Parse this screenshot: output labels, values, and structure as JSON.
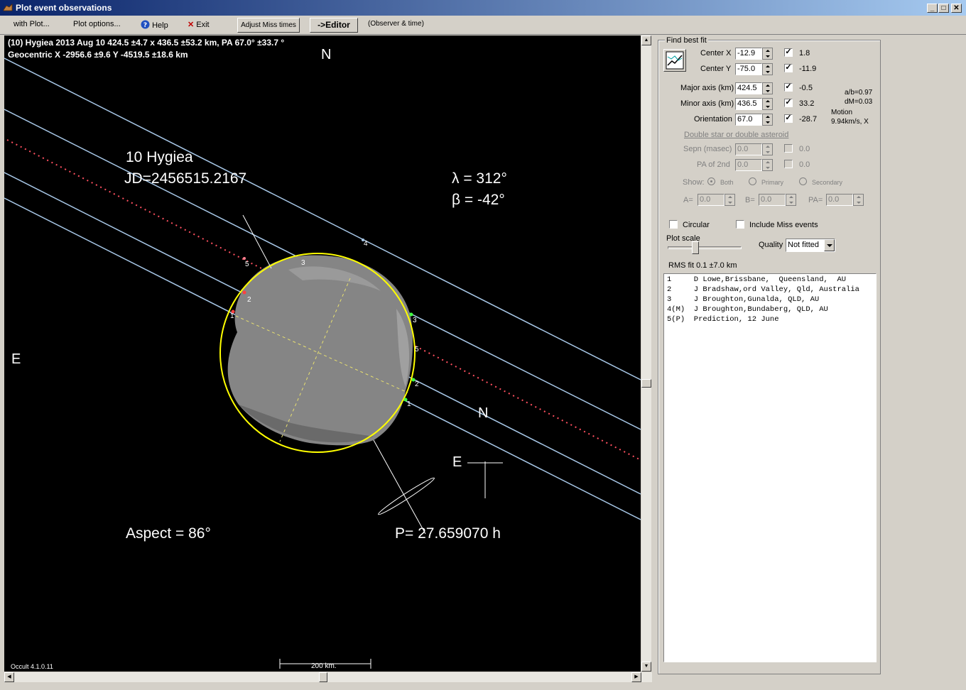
{
  "window": {
    "title": "Plot event observations",
    "buttons": {
      "minimize": "_",
      "maximize": "□",
      "close": "✕"
    }
  },
  "menu": {
    "with_plot": "with Plot...",
    "plot_options": "Plot options...",
    "help": "Help",
    "exit": "Exit",
    "adjust_miss": "Adjust Miss times",
    "editor": "->Editor",
    "observer_time": "(Observer & time)"
  },
  "plot": {
    "header_line1": "(10) Hygiea  2013 Aug 10   424.5 ±4.7 x 436.5 ±53.2 km, PA 67.0° ±33.7 °",
    "header_line2": "Geocentric X -2956.6 ±9.6  Y -4519.5 ±18.6 km",
    "north_label": "N",
    "east_label": "E",
    "asteroid_name": "10 Hygiea",
    "jd": "JD=2456515.2167",
    "lambda": "λ =  312°",
    "beta": "β =  -42°",
    "aspect": "Aspect = 86°",
    "period": "P= 27.659070 h",
    "compass_n": "N",
    "compass_e": "E",
    "scale_label": "200 km.",
    "version": "Occult 4.1.0.11",
    "chord_labels": [
      "1",
      "2",
      "3",
      "4",
      "5"
    ],
    "colors": {
      "chord": "#a8c8e8",
      "prediction": "#ff5060",
      "ellipse": "#ffff00",
      "disappear": "#ff4040",
      "reappear": "#40ff40"
    }
  },
  "panel": {
    "find_best_fit": "Find best fit",
    "center_x": {
      "label": "Center X",
      "value": "-12.9",
      "checked": "✓",
      "delta": "1.8"
    },
    "center_y": {
      "label": "Center Y",
      "value": "-75.0",
      "checked": "✓",
      "delta": "-11.9"
    },
    "major": {
      "label": "Major axis (km)",
      "value": "424.5",
      "checked": "✓",
      "delta": "-0.5"
    },
    "minor": {
      "label": "Minor axis (km)",
      "value": "436.5",
      "checked": "✓",
      "delta": "33.2"
    },
    "orient": {
      "label": "Orientation",
      "value": "67.0",
      "checked": "✓",
      "delta": "-28.7"
    },
    "ab": "a/b=0.97",
    "dm": "dM=0.03",
    "motion_label": "Motion",
    "motion_value": "9.94km/s, X",
    "double_star": "Double star  or  double asteroid",
    "sepn": {
      "label": "Sepn (masec)",
      "value": "0.0",
      "delta": "0.0"
    },
    "pa2": {
      "label": "PA of 2nd",
      "value": "0.0",
      "delta": "0.0"
    },
    "show": "Show:",
    "both": "Both",
    "primary": "Primary",
    "secondary": "Secondary",
    "a_label": "A=",
    "a_value": "0.0",
    "b_label": "B=",
    "b_value": "0.0",
    "pa_label": "PA=",
    "pa_value": "0.0",
    "circular": "Circular",
    "include_miss": "Include Miss events",
    "plot_scale": "Plot scale",
    "quality_label": "Quality",
    "quality_value": "Not fitted",
    "rms": "RMS fit 0.1 ±7.0 km",
    "observations": [
      "1     D Lowe,Brissbane,  Queensland,  AU",
      "2     J Bradshaw,ord Valley, Qld, Australia",
      "3     J Broughton,Gunalda, QLD, AU",
      "4(M)  J Broughton,Bundaberg, QLD, AU",
      "5(P)  Prediction, 12 June"
    ]
  },
  "scroll": {
    "up": "▲",
    "down": "▼",
    "left": "◀",
    "right": "▶"
  }
}
